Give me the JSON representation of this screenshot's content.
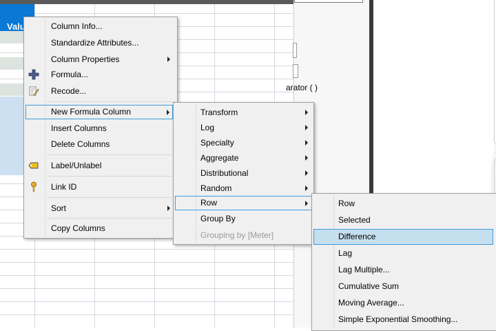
{
  "table": {
    "header": "Value"
  },
  "panel": {
    "text": "arator ( )"
  },
  "context_menu": {
    "items": [
      "Column Info...",
      "Standardize Attributes...",
      "Column Properties",
      "Formula...",
      "Recode...",
      "New Formula Column",
      "Insert Columns",
      "Delete Columns",
      "Label/Unlabel",
      "Link ID",
      "Sort",
      "Copy Columns"
    ]
  },
  "new_formula_submenu": {
    "items": [
      "Transform",
      "Log",
      "Specialty",
      "Aggregate",
      "Distributional",
      "Random",
      "Row",
      "Group By",
      "Grouping by [Meter]"
    ]
  },
  "row_submenu": {
    "items": [
      "Row",
      "Selected",
      "Difference",
      "Lag",
      "Lag Multiple...",
      "Cumulative Sum",
      "Moving Average...",
      "Simple Exponential Smoothing..."
    ]
  },
  "colors": {
    "header": "#0a78d4",
    "highlight": "#c5dfee",
    "highlight_border": "#3c9ade"
  }
}
